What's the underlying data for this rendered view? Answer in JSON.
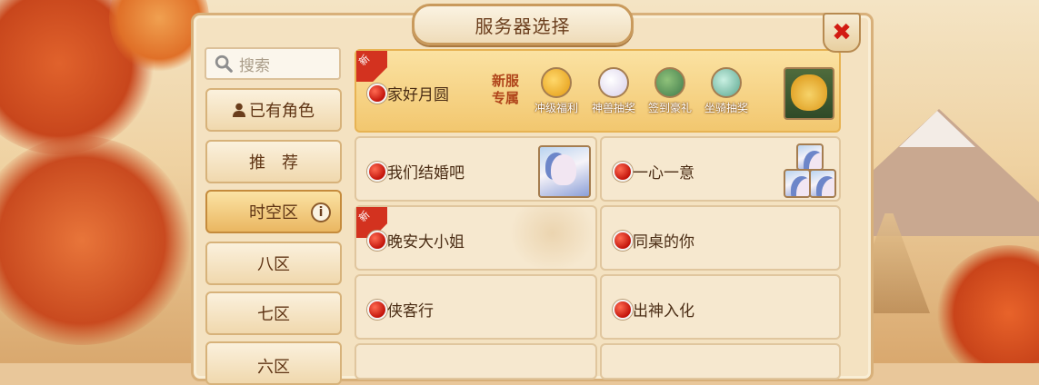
{
  "title": "服务器选择",
  "search": {
    "placeholder": "搜索"
  },
  "sidebar": {
    "items": [
      {
        "label": "已有角色",
        "active": false,
        "icon": "user-icon"
      },
      {
        "label": "推　荐",
        "active": false
      },
      {
        "label": "时空区",
        "active": true,
        "info_icon": "i"
      },
      {
        "label": "八区",
        "active": false
      },
      {
        "label": "七区",
        "active": false
      },
      {
        "label": "六区",
        "active": false
      }
    ]
  },
  "featured": {
    "new_tag": "新",
    "name": "家好月圆",
    "promo_label_line1": "新服",
    "promo_label_line2": "专属",
    "perks": [
      {
        "label": "冲级福利",
        "icon": "level-up-gift-icon",
        "color": "#f3b21b"
      },
      {
        "label": "神兽抽奖",
        "icon": "mythic-beast-icon",
        "color": "#e7e3f6"
      },
      {
        "label": "签到豪礼",
        "icon": "signin-gift-icon",
        "color": "#4b8d5a"
      },
      {
        "label": "坐骑抽奖",
        "icon": "mount-draw-icon",
        "color": "#73c4b0"
      }
    ]
  },
  "servers": [
    {
      "name": "我们结婚吧",
      "new": false
    },
    {
      "name": "一心一意",
      "new": false
    },
    {
      "name": "晚安大小姐",
      "new": true,
      "new_tag": "新"
    },
    {
      "name": "同桌的你",
      "new": false
    },
    {
      "name": "侠客行",
      "new": false
    },
    {
      "name": "出神入化",
      "new": false
    }
  ],
  "colors": {
    "status_dot": "#c3140b",
    "accent": "#e7b353"
  }
}
